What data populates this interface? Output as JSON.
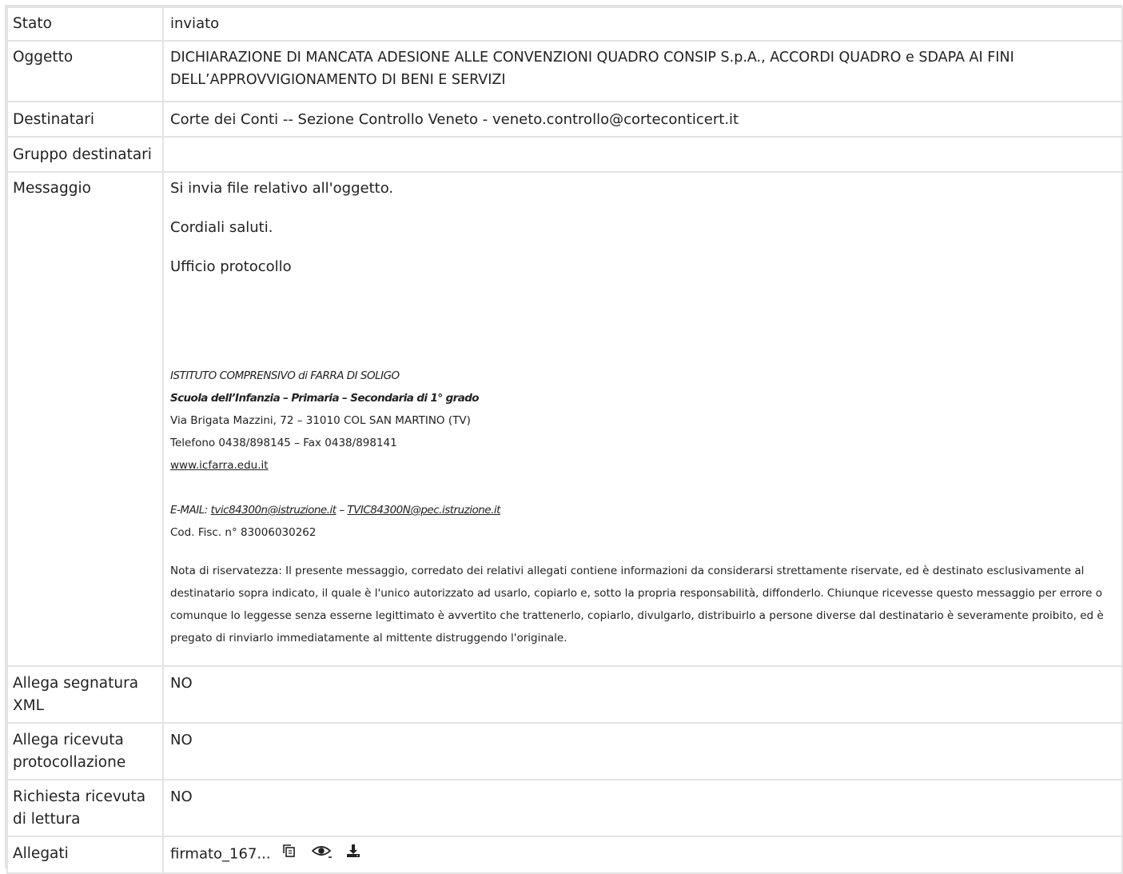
{
  "rows": {
    "stato": {
      "label": "Stato",
      "value": "inviato"
    },
    "oggetto": {
      "label": "Oggetto",
      "value": "DICHIARAZIONE DI MANCATA ADESIONE ALLE CONVENZIONI QUADRO CONSIP S.p.A., ACCORDI QUADRO e SDAPA AI FINI DELL’APPROVVIGIONAMENTO DI BENI E SERVIZI"
    },
    "destinatari": {
      "label": "Destinatari",
      "value": "Corte dei Conti -- Sezione Controllo Veneto - veneto.controllo@corteconticert.it"
    },
    "gruppo": {
      "label": "Gruppo destinatari",
      "value": ""
    },
    "messaggio": {
      "label": "Messaggio",
      "line1": "Si invia file relativo all'oggetto.",
      "line2": "Cordiali saluti.",
      "line3": "Ufficio protocollo",
      "sig_school": "ISTITUTO COMPRENSIVO di FARRA DI SOLIGO",
      "sig_levels": "Scuola dell’Infanzia – Primaria – Secondaria di 1° grado",
      "sig_address": "Via Brigata Mazzini, 72 – 31010 COL SAN MARTINO (TV)",
      "sig_phone": "Telefono 0438/898145 – Fax 0438/898141",
      "sig_web": "www.icfarra.edu.it ",
      "sig_email_label": "E-MAIL: ",
      "sig_email1": "tvic84300n@istruzione.it",
      "sig_email_sep": " – ",
      "sig_email2": "TVIC84300N@pec.istruzione.it",
      "sig_cf": "Cod. Fisc. n° 83006030262",
      "disclaimer": "Nota di riservatezza: Il presente messaggio, corredato dei relativi allegati contiene informazioni da considerarsi strettamente riservate, ed è destinato esclusivamente al destinatario sopra indicato, il quale è l'unico autorizzato ad usarlo, copiarlo e, sotto la propria responsabilità, diffonderlo. Chiunque ricevesse questo messaggio per errore o comunque lo leggesse senza esserne legittimato è avvertito che trattenerlo, copiarlo, divulgarlo, distribuirlo a persone diverse dal destinatario è severamente proibito, ed è pregato di rinviarlo immediatamente al mittente distruggendo l'originale."
    },
    "segnatura": {
      "label": "Allega segnatura XML",
      "value": "NO"
    },
    "ricevuta_prot": {
      "label": "Allega ricevuta protocollazione",
      "value": "NO"
    },
    "ricevuta_lettura": {
      "label": "Richiesta ricevuta di lettura",
      "value": "NO"
    },
    "allegati": {
      "label": "Allegati",
      "file_name": "firmato_167..."
    }
  },
  "icons": {
    "copy": "copy-icon",
    "preview": "eye-icon",
    "download": "download-icon"
  }
}
